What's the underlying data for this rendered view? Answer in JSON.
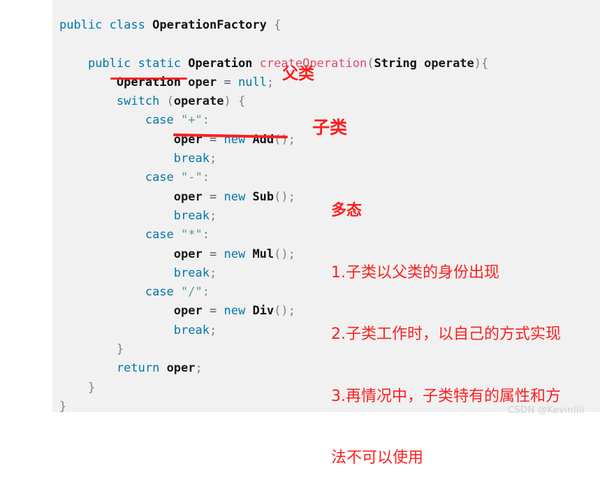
{
  "panel": {
    "background_color": "#f1f1f1",
    "page_background_color": "#ffffff"
  },
  "code": {
    "language": "java",
    "lines": [
      "public class OperationFactory {",
      "",
      "    public static Operation createOperation(String operate){",
      "        Operation oper = null;",
      "        switch (operate) {",
      "            case \"+\":",
      "                oper = new Add();",
      "                break;",
      "            case \"-\":",
      "                oper = new Sub();",
      "                break;",
      "            case \"*\":",
      "                oper = new Mul();",
      "                break;",
      "            case \"/\":",
      "                oper = new Div();",
      "                break;",
      "        }",
      "        return oper;",
      "    }",
      "}"
    ],
    "colors": {
      "keyword": "#0077aa",
      "type": "#111111",
      "variable": "#1a1a1a",
      "function": "#dd4a68",
      "string": "#5f9e6e",
      "punctuation": "#7a8287",
      "default_text": "#333333"
    }
  },
  "annotations": {
    "color": "#fb2020",
    "superclass_label": "父类",
    "subclass_label": "子类",
    "polymorphism": {
      "heading": "多态",
      "items": [
        "1.子类以父类的身份出现",
        "2.子类工作时，以自己的方式实现",
        "3.再情况中，子类特有的属性和方",
        "法不可以使用"
      ]
    },
    "underlines": [
      {
        "target": "Operation",
        "note": "red underline under the Operation type declaration"
      },
      {
        "target": "oper = new Add();",
        "note": "red underline under the Add instantiation statement"
      }
    ]
  },
  "watermark": {
    "text": "CSDN @Kevinllli",
    "color": "#cfcfcf"
  }
}
